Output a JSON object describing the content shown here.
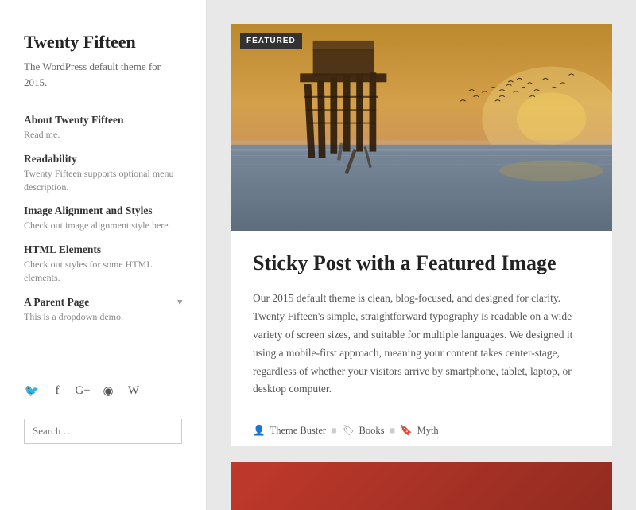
{
  "site": {
    "title": "Twenty Fifteen",
    "description": "The WordPress default theme for 2015."
  },
  "nav": {
    "items": [
      {
        "id": "about",
        "label": "About Twenty Fifteen",
        "desc": "Read me.",
        "dropdown": false
      },
      {
        "id": "readability",
        "label": "Readability",
        "desc": "Twenty Fifteen supports optional menu description.",
        "dropdown": false
      },
      {
        "id": "image-alignment",
        "label": "Image Alignment and Styles",
        "desc": "Check out image alignment style here.",
        "dropdown": false
      },
      {
        "id": "html-elements",
        "label": "HTML Elements",
        "desc": "Check out styles for some HTML elements.",
        "dropdown": false
      },
      {
        "id": "a-parent-page",
        "label": "A Parent Page",
        "desc": "This is a dropdown demo.",
        "dropdown": true
      }
    ]
  },
  "social": {
    "icons": [
      {
        "name": "twitter",
        "symbol": "𝕏"
      },
      {
        "name": "facebook",
        "symbol": "f"
      },
      {
        "name": "googleplus",
        "symbol": "G+"
      },
      {
        "name": "github",
        "symbol": "◉"
      },
      {
        "name": "wordpress",
        "symbol": "W"
      }
    ]
  },
  "search": {
    "placeholder": "Search …"
  },
  "post": {
    "badge": "FEATURED",
    "title": "Sticky Post with a Featured Image",
    "excerpt": "Our 2015 default theme is clean, blog-focused, and designed for clarity. Twenty Fifteen's simple, straightforward typography is readable on a wide variety of screen sizes, and suitable for multiple languages. We designed it using a mobile-first approach, meaning your content takes center-stage, regardless of whether your visitors arrive by smartphone, tablet, laptop, or desktop computer.",
    "author": "Theme Buster",
    "categories": [
      "Books"
    ],
    "tags": [
      "Myth"
    ]
  }
}
